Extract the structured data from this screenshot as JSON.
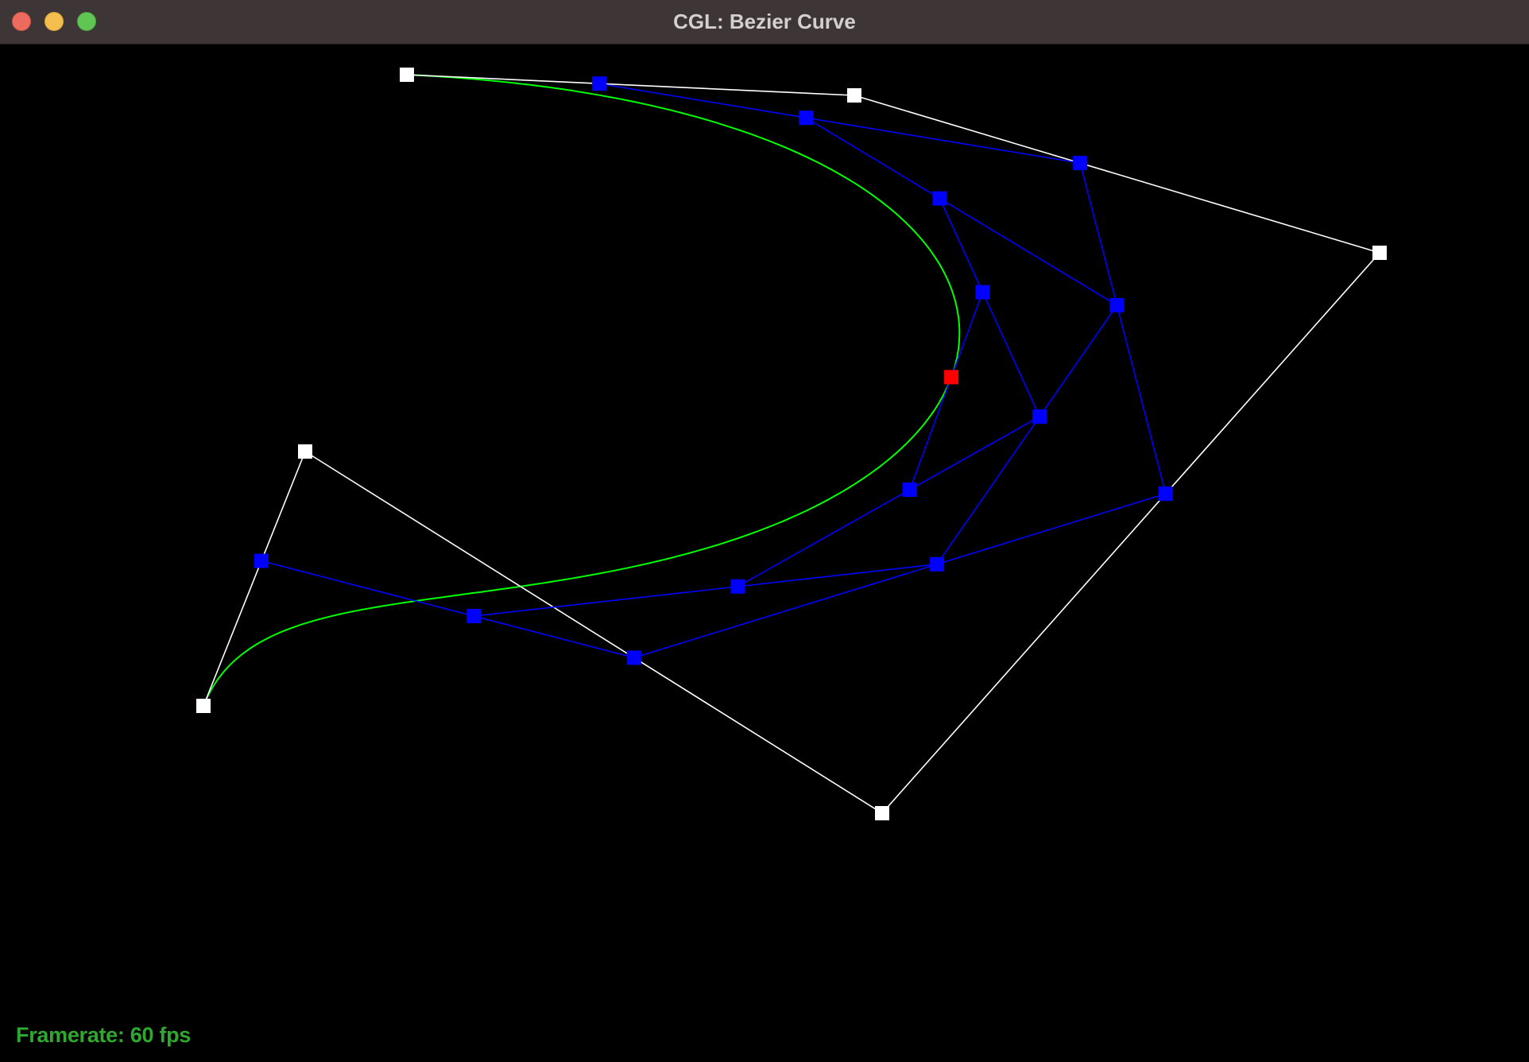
{
  "window": {
    "title": "CGL: Bezier Curve",
    "buttons": {
      "close": "close-button",
      "minimize": "minimize-button",
      "maximize": "maximize-button"
    }
  },
  "scene": {
    "colors": {
      "background": "#000000",
      "control_polygon": "#ffffff",
      "intermediate": "#0000ff",
      "curve": "#00ff00",
      "evaluated_point": "#ff0000"
    }
  },
  "hud": {
    "framerate_text": "Framerate: 60 fps"
  }
}
